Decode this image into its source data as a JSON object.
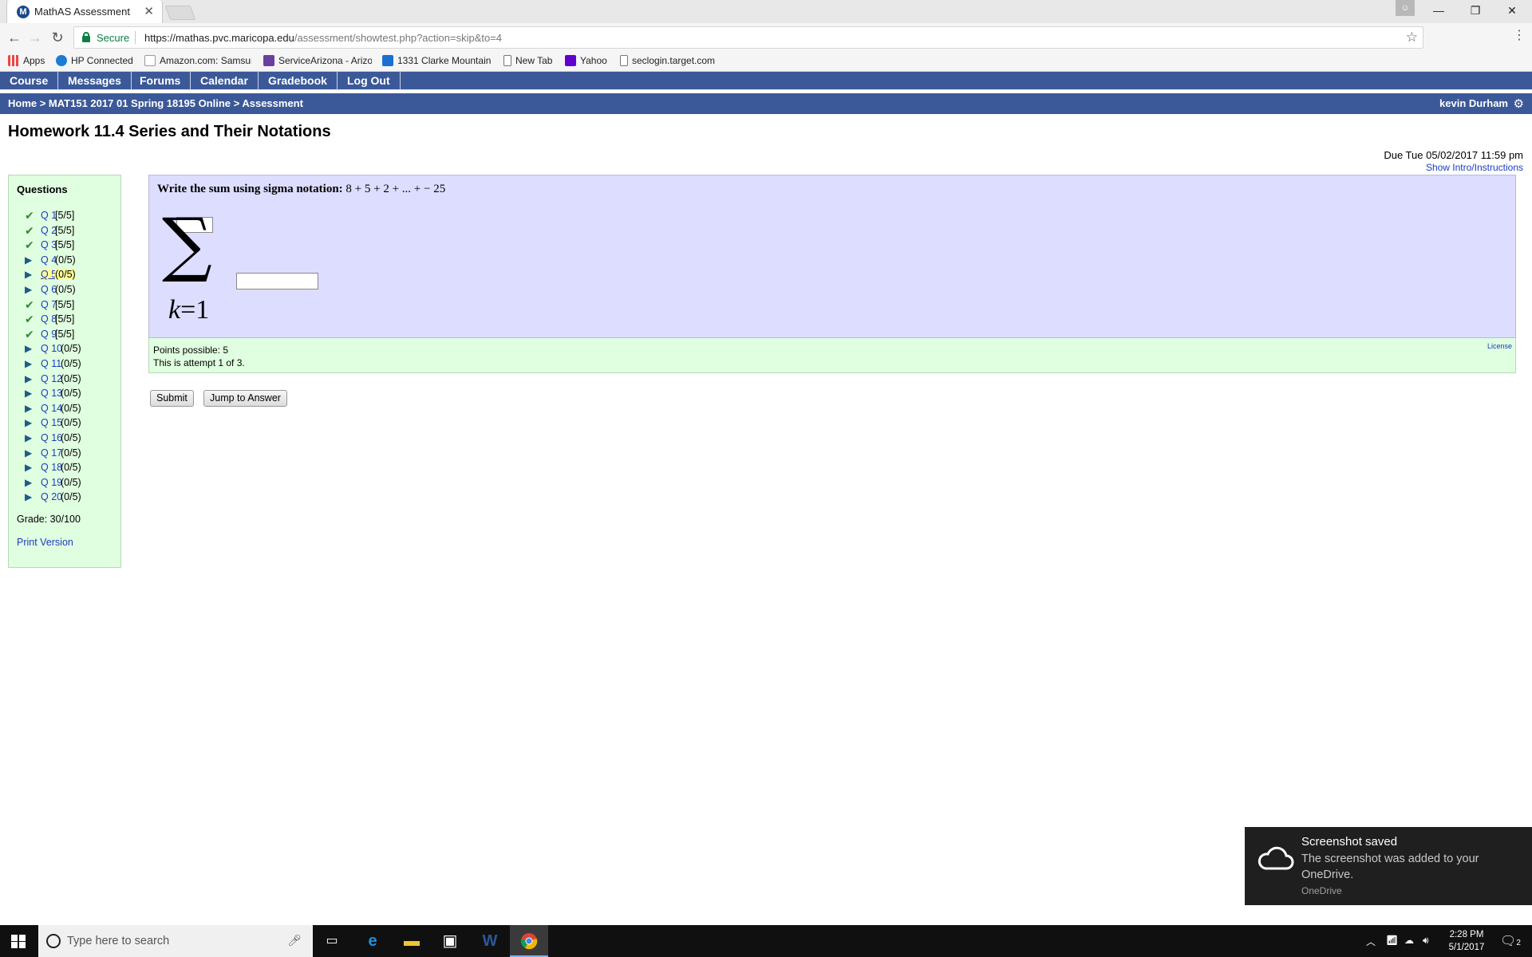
{
  "browser": {
    "tab_title": "MathAS Assessment",
    "tab_close": "✕",
    "secure_label": "Secure",
    "url_host": "https://mathas.pvc.maricopa.edu",
    "url_path": "/assessment/showtest.php?action=skip&to=4",
    "bookmarks": [
      {
        "label": "Apps"
      },
      {
        "label": "HP Connected"
      },
      {
        "label": "Amazon.com: Samsun"
      },
      {
        "label": "ServiceArizona - Arizo"
      },
      {
        "label": "1331 Clarke Mountain"
      },
      {
        "label": "New Tab"
      },
      {
        "label": "Yahoo"
      },
      {
        "label": "seclogin.target.com"
      }
    ]
  },
  "site_nav": {
    "items": [
      "Course",
      "Messages",
      "Forums",
      "Calendar",
      "Gradebook",
      "Log Out"
    ]
  },
  "breadcrumb": {
    "text": "Home > MAT151 2017 01 Spring 18195 Online > Assessment",
    "user": "kevin Durham"
  },
  "assessment": {
    "title": "Homework 11.4 Series and Their Notations",
    "due": "Due Tue 05/02/2017 11:59 pm",
    "show_intro": "Show Intro/Instructions",
    "questions_heading": "Questions",
    "questions": [
      {
        "label": "Q 1",
        "score": "[5/5]",
        "done": true
      },
      {
        "label": "Q 2",
        "score": "[5/5]",
        "done": true
      },
      {
        "label": "Q 3",
        "score": "[5/5]",
        "done": true
      },
      {
        "label": "Q 4",
        "score": "(0/5)",
        "done": false
      },
      {
        "label": "Q 5",
        "score": "(0/5)",
        "done": false
      },
      {
        "label": "Q 6",
        "score": "(0/5)",
        "done": false
      },
      {
        "label": "Q 7",
        "score": "[5/5]",
        "done": true
      },
      {
        "label": "Q 8",
        "score": "[5/5]",
        "done": true
      },
      {
        "label": "Q 9",
        "score": "[5/5]",
        "done": true
      },
      {
        "label": "Q 10",
        "score": "(0/5)",
        "done": false
      },
      {
        "label": "Q 11",
        "score": "(0/5)",
        "done": false
      },
      {
        "label": "Q 12",
        "score": "(0/5)",
        "done": false
      },
      {
        "label": "Q 13",
        "score": "(0/5)",
        "done": false
      },
      {
        "label": "Q 14",
        "score": "(0/5)",
        "done": false
      },
      {
        "label": "Q 15",
        "score": "(0/5)",
        "done": false
      },
      {
        "label": "Q 16",
        "score": "(0/5)",
        "done": false
      },
      {
        "label": "Q 17",
        "score": "(0/5)",
        "done": false
      },
      {
        "label": "Q 18",
        "score": "(0/5)",
        "done": false
      },
      {
        "label": "Q 19",
        "score": "(0/5)",
        "done": false
      },
      {
        "label": "Q 20",
        "score": "(0/5)",
        "done": false
      }
    ],
    "current_question": "Q 5",
    "grade": "Grade: 30/100",
    "print_version": "Print Version",
    "prompt_lead": "Write the sum using sigma notation:",
    "prompt_expr": "8 + 5 + 2 + ... + − 25",
    "sigma_symbol": "∑",
    "sigma_var": "k",
    "sigma_eq": "=",
    "sigma_start": "1",
    "upper_limit_value": "",
    "term_value": "",
    "points_possible": "Points possible: 5",
    "attempt": "This is attempt 1 of 3.",
    "license": "License",
    "submit_label": "Submit",
    "jump_label": "Jump to Answer"
  },
  "toast": {
    "title": "Screenshot saved",
    "body": "The screenshot was added to your OneDrive.",
    "app": "OneDrive"
  },
  "taskbar": {
    "search_placeholder": "Type here to search",
    "time": "2:28 PM",
    "date": "5/1/2017",
    "notification_count": "2"
  },
  "colors": {
    "nav_blue": "#3b5998",
    "question_bg": "#ddddff",
    "panel_green": "#e0ffe0",
    "link_blue": "#1a3cbf",
    "check_green": "#2e8b3a",
    "current_highlight": "#ffff99"
  }
}
